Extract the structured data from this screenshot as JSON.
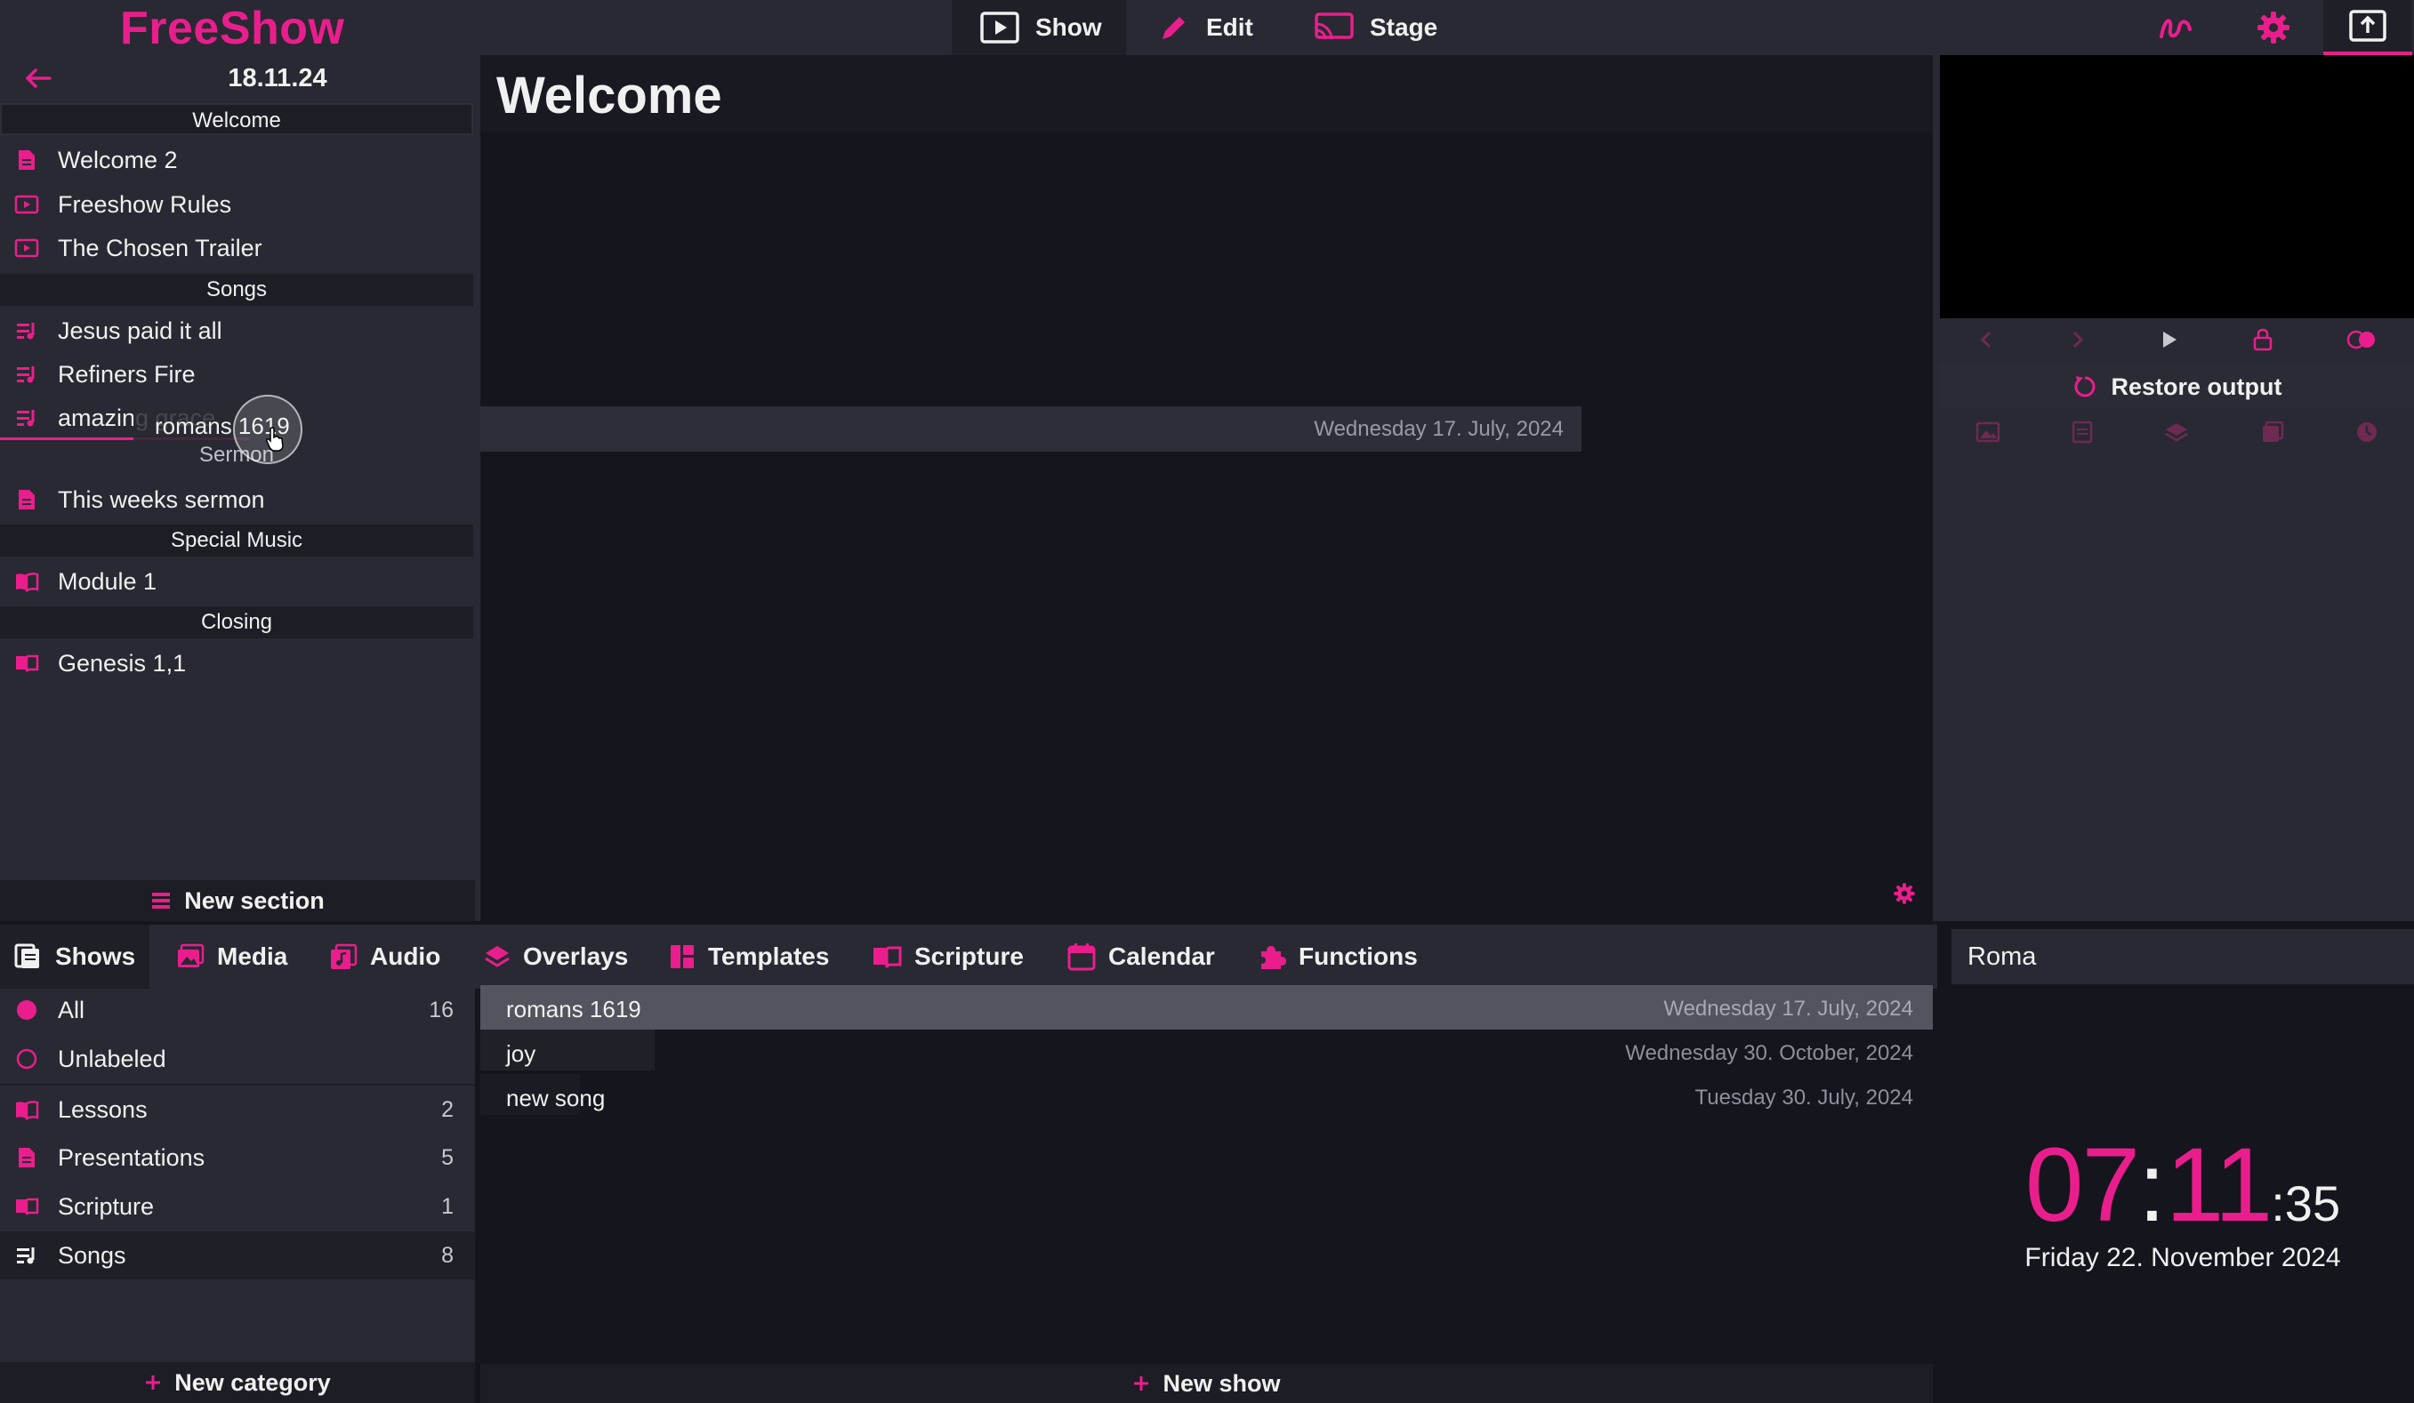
{
  "app": {
    "name": "FreeShow"
  },
  "modes": [
    {
      "label": "Show",
      "icon": "show-icon",
      "active": true
    },
    {
      "label": "Edit",
      "icon": "edit-icon",
      "active": false
    },
    {
      "label": "Stage",
      "icon": "stage-icon",
      "active": false
    }
  ],
  "top_icons": [
    "draw-icon",
    "settings-gear-icon",
    "output-icon"
  ],
  "colors": {
    "accent": "#e91e8c",
    "panel": "#292933",
    "background": "#15151d",
    "section": "#1d1d25"
  },
  "project": {
    "date": "18.11.24",
    "sections": [
      {
        "name": "Welcome",
        "items": [
          {
            "label": "Welcome 2",
            "icon": "presentation-icon"
          },
          {
            "label": "Freeshow Rules",
            "icon": "video-icon"
          },
          {
            "label": "The Chosen Trailer",
            "icon": "video-icon"
          }
        ]
      },
      {
        "name": "Songs",
        "items": [
          {
            "label": "Jesus paid it all",
            "icon": "song-icon"
          },
          {
            "label": "Refiners Fire",
            "icon": "song-icon"
          },
          {
            "label": "amazing grace",
            "icon": "song-icon"
          }
        ]
      },
      {
        "name": "Sermon",
        "items": [
          {
            "label": "This weeks sermon",
            "icon": "presentation-icon"
          }
        ]
      },
      {
        "name": "Special Music",
        "items": [
          {
            "label": "Module 1",
            "icon": "lesson-icon"
          }
        ]
      },
      {
        "name": "Closing",
        "items": [
          {
            "label": "Genesis 1,1",
            "icon": "scripture-icon"
          }
        ]
      }
    ],
    "new_section_label": "New section"
  },
  "drag": {
    "ghost_label": "romans 1619",
    "row_date": "Wednesday 17. July, 2024"
  },
  "show": {
    "title": "Welcome"
  },
  "output": {
    "restore_label": "Restore output"
  },
  "drawer": {
    "tabs": [
      {
        "label": "Shows",
        "icon": "shows-icon",
        "active": true
      },
      {
        "label": "Media",
        "icon": "media-icon"
      },
      {
        "label": "Audio",
        "icon": "audio-icon"
      },
      {
        "label": "Overlays",
        "icon": "overlays-icon"
      },
      {
        "label": "Templates",
        "icon": "templates-icon"
      },
      {
        "label": "Scripture",
        "icon": "scripture-icon"
      },
      {
        "label": "Calendar",
        "icon": "calendar-icon"
      },
      {
        "label": "Functions",
        "icon": "functions-icon"
      }
    ],
    "categories": [
      {
        "label": "All",
        "count": "16",
        "icon": "dot-filled-icon"
      },
      {
        "label": "Unlabeled",
        "count": "",
        "icon": "dot-outline-icon"
      },
      {
        "label": "Lessons",
        "count": "2",
        "icon": "lesson-icon"
      },
      {
        "label": "Presentations",
        "count": "5",
        "icon": "presentation-icon"
      },
      {
        "label": "Scripture",
        "count": "1",
        "icon": "scripture-icon"
      },
      {
        "label": "Songs",
        "count": "8",
        "icon": "song-icon",
        "active": true
      }
    ],
    "new_category_label": "New category",
    "shows": [
      {
        "name": "romans 1619",
        "date": "Wednesday 17. July, 2024",
        "selected": true
      },
      {
        "name": "joy",
        "date": "Wednesday 30. October, 2024"
      },
      {
        "name": "new song",
        "date": "Tuesday 30. July, 2024"
      }
    ],
    "new_show_label": "New show"
  },
  "clock": {
    "label": "Roma",
    "hours": "07",
    "minutes": "11",
    "seconds": ":35",
    "date": "Friday 22. November 2024"
  }
}
